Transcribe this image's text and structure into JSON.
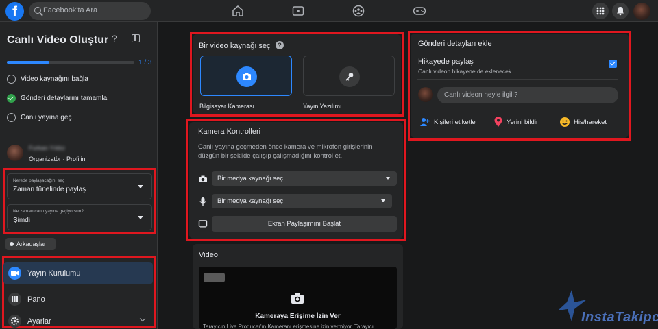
{
  "topbar": {
    "logo_letter": "f",
    "search_placeholder": "Facebook'ta Ara",
    "nav_icons": [
      "home-icon",
      "video-icon",
      "groups-icon",
      "gaming-icon"
    ],
    "right_icons": [
      "grid-menu-icon",
      "notifications-icon",
      "profile-avatar"
    ]
  },
  "sidebar": {
    "title": "Canlı Video Oluştur",
    "progress_text": "1 / 3",
    "progress_fraction": 0.333,
    "steps": [
      {
        "label": "Video kaynağını bağla",
        "state": "pending"
      },
      {
        "label": "Gönderi detaylarını tamamla",
        "state": "done"
      },
      {
        "label": "Canlı yayına geç",
        "state": "pending"
      }
    ],
    "user": {
      "name": "Furkan Yıldız",
      "role": "Organizatör · Profilin"
    },
    "where_select": {
      "small_label": "Nerede paylaşacağını seç",
      "value": "Zaman tünelinde paylaş"
    },
    "when_select": {
      "small_label": "Ne zaman canlı yayına geçiyorsun?",
      "value": "Şimdi"
    },
    "audience_button": "Arkadaşlar",
    "menu": [
      {
        "label": "Yayın Kurulumu",
        "icon": "live-setup-icon",
        "active": true
      },
      {
        "label": "Pano",
        "icon": "dashboard-icon",
        "active": false
      },
      {
        "label": "Ayarlar",
        "icon": "settings-icon",
        "active": false
      }
    ]
  },
  "video_source": {
    "title": "Bir video kaynağı seç",
    "options": [
      {
        "label": "Bilgisayar Kamerası",
        "icon": "camera-icon",
        "selected": true
      },
      {
        "label": "Yayın Yazılımı",
        "icon": "key-icon",
        "selected": false
      }
    ]
  },
  "camera_controls": {
    "title": "Kamera Kontrolleri",
    "description_line1": "Canlı yayına geçmeden önce kamera ve mikrofon girişlerinin",
    "description_line2": "düzgün bir şekilde çalışıp çalışmadığını kontrol et.",
    "camera_select": "Bir medya kaynağı seç",
    "mic_select": "Bir medya kaynağı seç",
    "share_button": "Ekran Paylaşımını Başlat"
  },
  "video": {
    "title": "Video",
    "permission_title": "Kameraya Erişime İzin Ver",
    "permission_text": "Tarayıcın Live Producer'ın Kameranı erişmesine izin vermiyor. Tarayıcı"
  },
  "post_details": {
    "title": "Gönderi detayları ekle",
    "story_title": "Hikayede paylaş",
    "story_subtitle": "Canlı videon hikayene de eklenecek.",
    "story_checked": true,
    "input_placeholder": "Canlı videon neyle ilgili?",
    "actions": [
      {
        "label": "Kişileri etiketle",
        "icon": "tag-people-icon",
        "color": "#2d88ff"
      },
      {
        "label": "Yerini bildir",
        "icon": "location-icon",
        "color": "#f3425f"
      },
      {
        "label": "His/hareket",
        "icon": "feeling-icon",
        "color": "#f7b928"
      }
    ]
  },
  "watermark": {
    "text": "InstaTakipci"
  },
  "colors": {
    "accent": "#2d88ff",
    "highlight": "#e0171f",
    "success": "#31a24c",
    "background": "#18191a",
    "card": "#242526"
  }
}
